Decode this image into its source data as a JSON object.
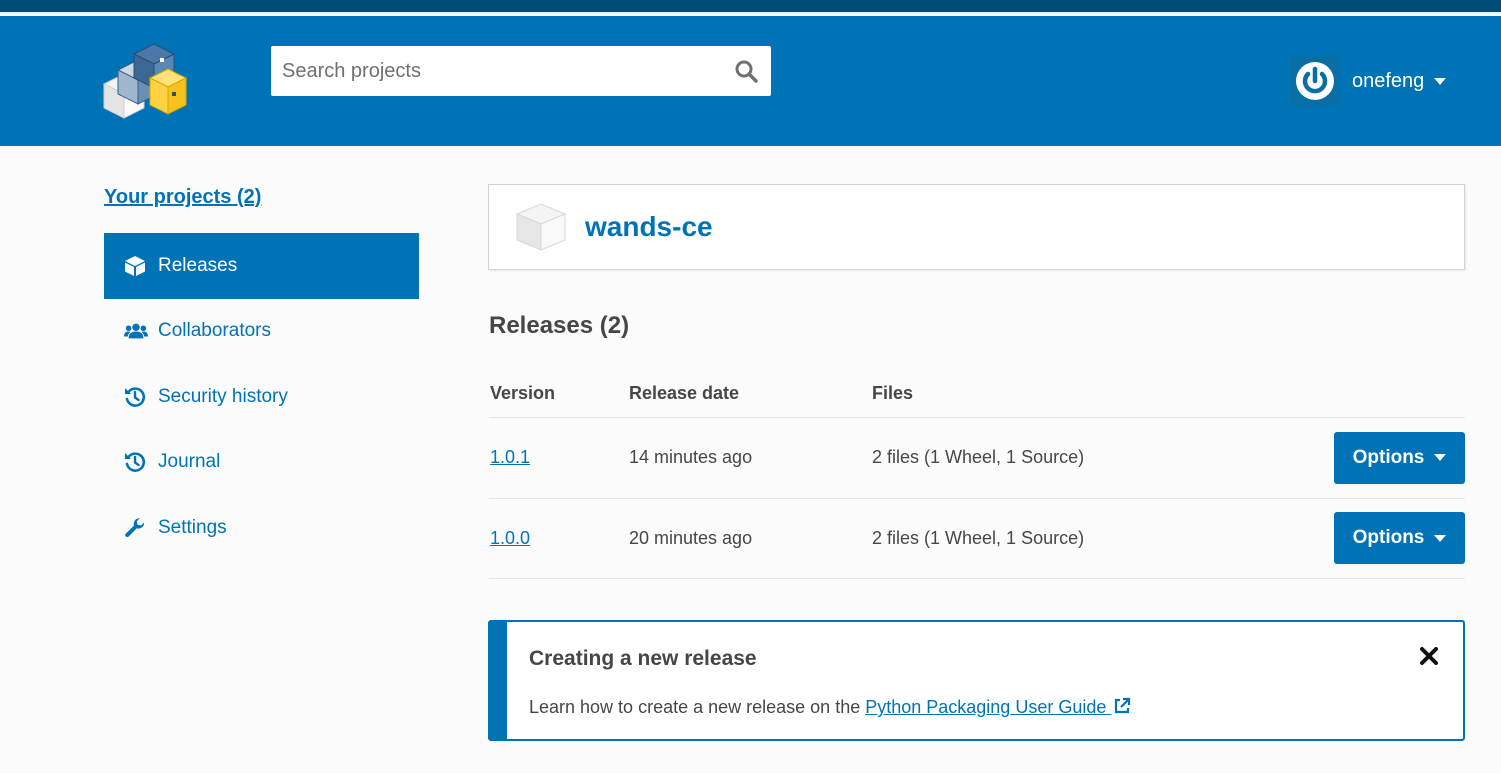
{
  "header": {
    "search_placeholder": "Search projects",
    "username": "onefeng",
    "logo": "pypi-logo",
    "avatar": "user-avatar"
  },
  "sidebar": {
    "your_projects": "Your projects (2)",
    "items": [
      {
        "label": "Releases",
        "icon": "box-icon",
        "active": true
      },
      {
        "label": "Collaborators",
        "icon": "users-icon",
        "active": false
      },
      {
        "label": "Security history",
        "icon": "history-icon",
        "active": false
      },
      {
        "label": "Journal",
        "icon": "history-icon",
        "active": false
      },
      {
        "label": "Settings",
        "icon": "wrench-icon",
        "active": false
      }
    ]
  },
  "project": {
    "name": "wands-ce"
  },
  "releases": {
    "title": "Releases (2)",
    "columns": [
      "Version",
      "Release date",
      "Files"
    ],
    "rows": [
      {
        "version": "1.0.1",
        "date": "14 minutes ago",
        "files": "2 files (1 Wheel, 1 Source)",
        "options": "Options"
      },
      {
        "version": "1.0.0",
        "date": "20 minutes ago",
        "files": "2 files (1 Wheel, 1 Source)",
        "options": "Options"
      }
    ]
  },
  "callout": {
    "title": "Creating a new release",
    "text": "Learn how to create a new release on the ",
    "link": "Python Packaging User Guide"
  },
  "colors": {
    "brand_blue": "#0073b7",
    "top_strip": "#004b78",
    "logo_yellow": "#ffd242"
  }
}
